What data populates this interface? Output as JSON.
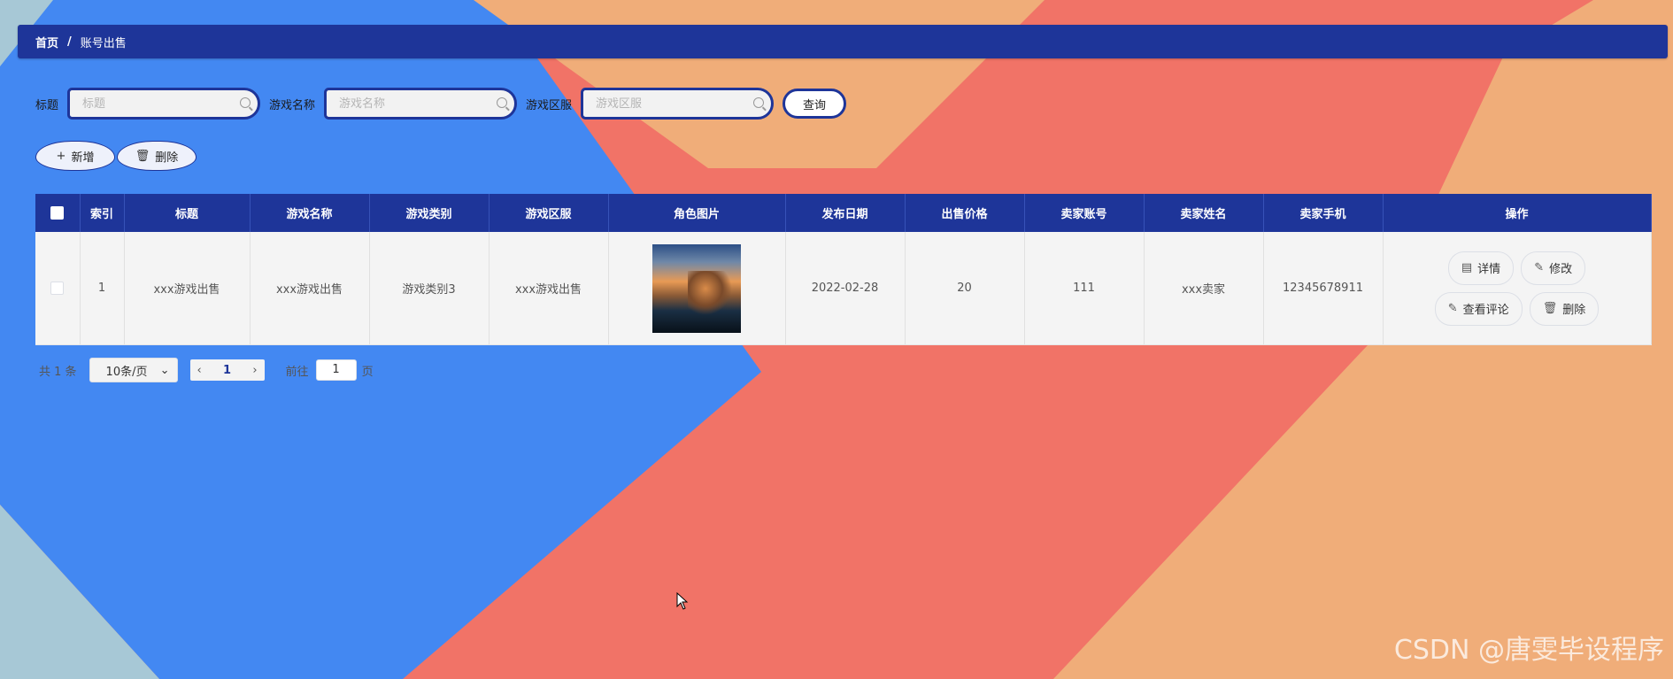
{
  "colors": {
    "primary": "#1e3599",
    "bg_blue": "#4388f2",
    "bg_orange": "#f0ad79",
    "bg_red": "#f17367",
    "bg_lightblue": "#a7c8d6"
  },
  "breadcrumb": {
    "home": "首页",
    "separator": "/",
    "current": "账号出售"
  },
  "search": {
    "title_label": "标题",
    "title_placeholder": "标题",
    "game_name_label": "游戏名称",
    "game_name_placeholder": "游戏名称",
    "server_label": "游戏区服",
    "server_placeholder": "游戏区服",
    "query_label": "查询"
  },
  "actions": {
    "add_label": "新增",
    "delete_label": "删除"
  },
  "table": {
    "columns": [
      "索引",
      "标题",
      "游戏名称",
      "游戏类别",
      "游戏区服",
      "角色图片",
      "发布日期",
      "出售价格",
      "卖家账号",
      "卖家姓名",
      "卖家手机",
      "操作"
    ],
    "rows": [
      {
        "index": "1",
        "title": "xxx游戏出售",
        "game_name": "xxx游戏出售",
        "game_category": "游戏类别3",
        "server": "xxx游戏出售",
        "publish_date": "2022-02-28",
        "price": "20",
        "seller_account": "111",
        "seller_name": "xxx卖家",
        "seller_phone": "12345678911",
        "ops": {
          "detail": "详情",
          "edit": "修改",
          "comments": "查看评论",
          "delete": "删除"
        }
      }
    ]
  },
  "pagination": {
    "total": "共 1 条",
    "page_size": "10条/页",
    "current_page": "1",
    "goto_label": "前往",
    "goto_value": "1",
    "page_suffix": "页"
  },
  "watermark": "CSDN @唐雯毕设程序"
}
